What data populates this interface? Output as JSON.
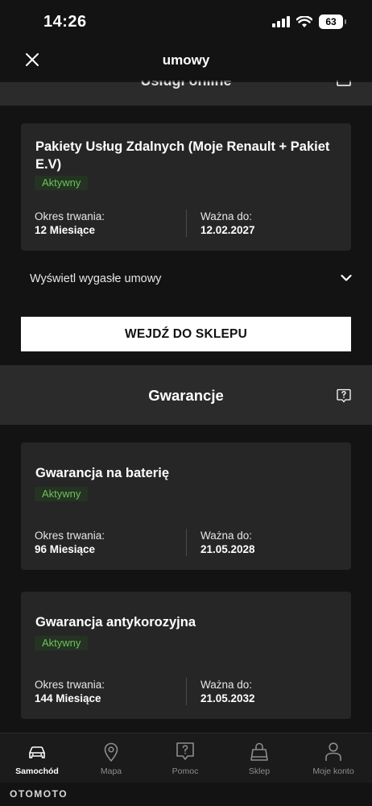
{
  "status_bar": {
    "time": "14:26",
    "battery": "63"
  },
  "nav": {
    "title": "umowy"
  },
  "partial_section": {
    "title": "Usługi online"
  },
  "cards": [
    {
      "title": "Pakiety Usług Zdalnych (Moje Renault + Pakiet E.V)",
      "badge": "Aktywny",
      "duration_label": "Okres trwania:",
      "duration_value": "12 Miesiące",
      "valid_label": "Ważna do:",
      "valid_value": "12.02.2027"
    },
    {
      "title": "Gwarancja na baterię",
      "badge": "Aktywny",
      "duration_label": "Okres trwania:",
      "duration_value": "96 Miesiące",
      "valid_label": "Ważna do:",
      "valid_value": "21.05.2028"
    },
    {
      "title": "Gwarancja antykorozyjna",
      "badge": "Aktywny",
      "duration_label": "Okres trwania:",
      "duration_value": "144 Miesiące",
      "valid_label": "Ważna do:",
      "valid_value": "21.05.2032"
    }
  ],
  "expired": {
    "label": "Wyświetl wygasłe umowy"
  },
  "shop_button": {
    "label": "WEJDŹ DO SKLEPU"
  },
  "warranty_section": {
    "title": "Gwarancje"
  },
  "tabs": [
    {
      "label": "Samochód",
      "icon": "car-icon",
      "active": true
    },
    {
      "label": "Mapa",
      "icon": "map-pin-icon",
      "active": false
    },
    {
      "label": "Pomoc",
      "icon": "help-icon",
      "active": false
    },
    {
      "label": "Sklep",
      "icon": "shopping-bag-icon",
      "active": false
    },
    {
      "label": "Moje konto",
      "icon": "user-icon",
      "active": false
    }
  ],
  "watermark": {
    "text": "OTOMOTO"
  },
  "colors": {
    "background": "#131313",
    "card": "#262626",
    "section_header": "#2b2b2b",
    "badge_bg": "#243322",
    "badge_text": "#6fbf5d",
    "tab_inactive": "#8d8d8d"
  }
}
